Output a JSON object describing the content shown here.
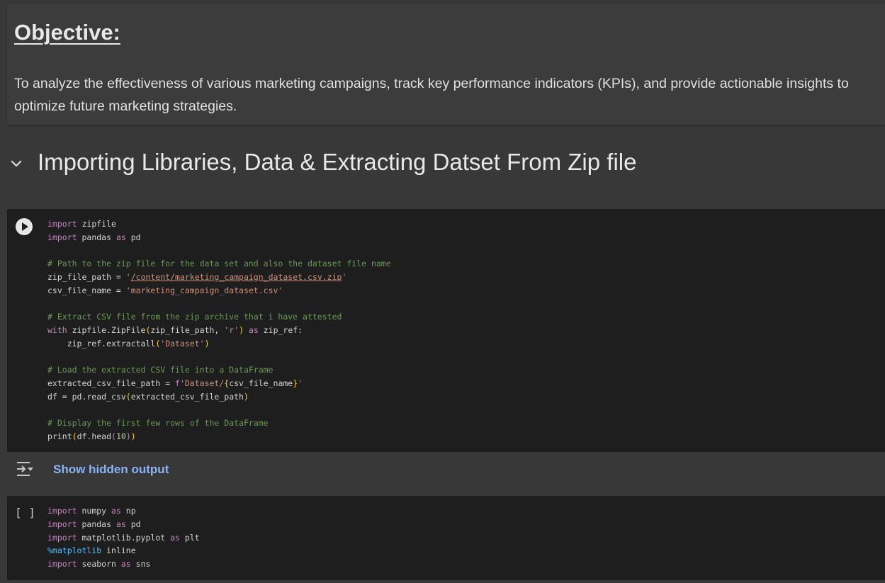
{
  "objective": {
    "title": "Objective:",
    "body": "To analyze the effectiveness of various marketing campaigns, track key performance indicators (KPIs), and provide actionable insights to optimize future marketing strategies."
  },
  "section": {
    "title": "Importing Libraries, Data & Extracting Datset From Zip file",
    "icon": "chevron-down-icon"
  },
  "cells": [
    {
      "run_icon": "play-icon",
      "lines": [
        [
          {
            "c": "kw",
            "t": "import"
          },
          {
            "c": "pn",
            "t": " zipfile"
          }
        ],
        [
          {
            "c": "kw",
            "t": "import"
          },
          {
            "c": "pn",
            "t": " pandas "
          },
          {
            "c": "kw",
            "t": "as"
          },
          {
            "c": "pn",
            "t": " pd"
          }
        ],
        [],
        [
          {
            "c": "cm",
            "t": "# Path to the zip file for the data set and also the dataset file name"
          }
        ],
        [
          {
            "c": "pn",
            "t": "zip_file_path = "
          },
          {
            "c": "st",
            "t": "'"
          },
          {
            "c": "stu",
            "t": "/content/marketing_campaign_dataset.csv.zip"
          },
          {
            "c": "st",
            "t": "'"
          }
        ],
        [
          {
            "c": "pn",
            "t": "csv_file_name = "
          },
          {
            "c": "st",
            "t": "'marketing_campaign_dataset.csv'"
          }
        ],
        [],
        [
          {
            "c": "cm",
            "t": "# Extract CSV file from the zip archive that i have attested"
          }
        ],
        [
          {
            "c": "kw",
            "t": "with"
          },
          {
            "c": "pn",
            "t": " zipfile.ZipFile"
          },
          {
            "c": "br",
            "t": "("
          },
          {
            "c": "pn",
            "t": "zip_file_path, "
          },
          {
            "c": "st",
            "t": "'r'"
          },
          {
            "c": "br",
            "t": ")"
          },
          {
            "c": "pn",
            "t": " "
          },
          {
            "c": "kw",
            "t": "as"
          },
          {
            "c": "pn",
            "t": " zip_ref:"
          }
        ],
        [
          {
            "c": "pn",
            "t": "    zip_ref.extractall"
          },
          {
            "c": "br",
            "t": "("
          },
          {
            "c": "st",
            "t": "'Dataset'"
          },
          {
            "c": "br",
            "t": ")"
          }
        ],
        [],
        [
          {
            "c": "cm",
            "t": "# Load the extracted CSV file into a DataFrame"
          }
        ],
        [
          {
            "c": "pn",
            "t": "extracted_csv_file_path = "
          },
          {
            "c": "kw",
            "t": "f"
          },
          {
            "c": "st",
            "t": "'Dataset/"
          },
          {
            "c": "br",
            "t": "{"
          },
          {
            "c": "pn",
            "t": "csv_file_name"
          },
          {
            "c": "br",
            "t": "}"
          },
          {
            "c": "st",
            "t": "'"
          }
        ],
        [
          {
            "c": "pn",
            "t": "df = pd.read_csv"
          },
          {
            "c": "br",
            "t": "("
          },
          {
            "c": "pn",
            "t": "extracted_csv_file_path"
          },
          {
            "c": "br",
            "t": ")"
          }
        ],
        [],
        [
          {
            "c": "cm",
            "t": "# Display the first few rows of the DataFrame"
          }
        ],
        [
          {
            "c": "pn",
            "t": "print"
          },
          {
            "c": "br",
            "t": "("
          },
          {
            "c": "pn",
            "t": "df.head"
          },
          {
            "c": "kw",
            "t": "("
          },
          {
            "c": "nm",
            "t": "10"
          },
          {
            "c": "kw",
            "t": ")"
          },
          {
            "c": "br",
            "t": ")"
          }
        ]
      ]
    },
    {
      "exec_count": "[ ]",
      "lines": [
        [
          {
            "c": "kw",
            "t": "import"
          },
          {
            "c": "pn",
            "t": " numpy "
          },
          {
            "c": "kw",
            "t": "as"
          },
          {
            "c": "pn",
            "t": " np"
          }
        ],
        [
          {
            "c": "kw",
            "t": "import"
          },
          {
            "c": "pn",
            "t": " pandas "
          },
          {
            "c": "kw",
            "t": "as"
          },
          {
            "c": "pn",
            "t": " pd"
          }
        ],
        [
          {
            "c": "kw",
            "t": "import"
          },
          {
            "c": "pn",
            "t": " matplotlib.pyplot "
          },
          {
            "c": "kw",
            "t": "as"
          },
          {
            "c": "pn",
            "t": " plt"
          }
        ],
        [
          {
            "c": "mg",
            "t": "%matplotlib"
          },
          {
            "c": "pn",
            "t": " inline"
          }
        ],
        [
          {
            "c": "kw",
            "t": "import"
          },
          {
            "c": "pn",
            "t": " seaborn "
          },
          {
            "c": "kw",
            "t": "as"
          },
          {
            "c": "pn",
            "t": " sns"
          }
        ]
      ]
    }
  ],
  "output": {
    "icon": "output-toggle-icon",
    "label": "Show hidden output"
  },
  "colors": {
    "link": "#8ab4f8",
    "keyword": "#c586c0",
    "comment": "#6a9955",
    "string": "#ce9178"
  }
}
